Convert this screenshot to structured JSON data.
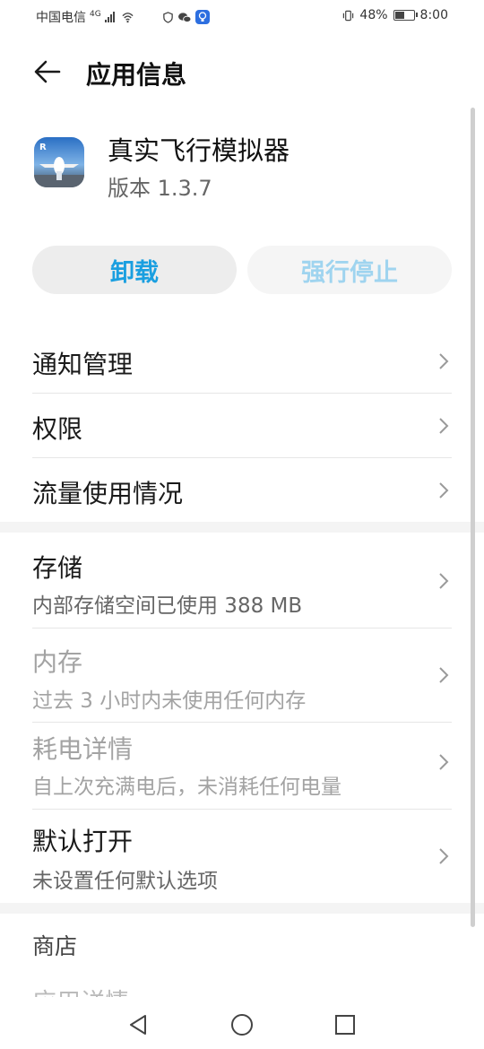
{
  "status_bar": {
    "carrier": "中国电信",
    "network": "4G",
    "battery": "48%",
    "time": "8:00"
  },
  "header": {
    "title": "应用信息"
  },
  "app": {
    "name": "真实飞行模拟器",
    "version": "版本 1.3.7"
  },
  "actions": {
    "uninstall": "卸载",
    "force_stop": "强行停止"
  },
  "list1": [
    {
      "label": "通知管理"
    },
    {
      "label": "权限"
    },
    {
      "label": "流量使用情况"
    }
  ],
  "list2": [
    {
      "label": "存储",
      "sub": "内部存储空间已使用 388 MB",
      "enabled": true
    },
    {
      "label": "内存",
      "sub": "过去 3 小时内未使用任何内存",
      "enabled": false
    },
    {
      "label": "耗电详情",
      "sub": "自上次充满电后，未消耗任何电量",
      "enabled": false
    },
    {
      "label": "默认打开",
      "sub": "未设置任何默认选项",
      "enabled": true
    }
  ],
  "store": {
    "title": "商店",
    "cut_item": "应用详情"
  },
  "icons": {
    "back": "arrow-left-icon",
    "chevron": "chevron-right-icon",
    "nav_back": "triangle-back-icon",
    "nav_home": "circle-home-icon",
    "nav_recent": "square-recent-icon"
  },
  "colors": {
    "accent": "#1a9fe0",
    "accent_disabled": "#9fd4ef"
  }
}
